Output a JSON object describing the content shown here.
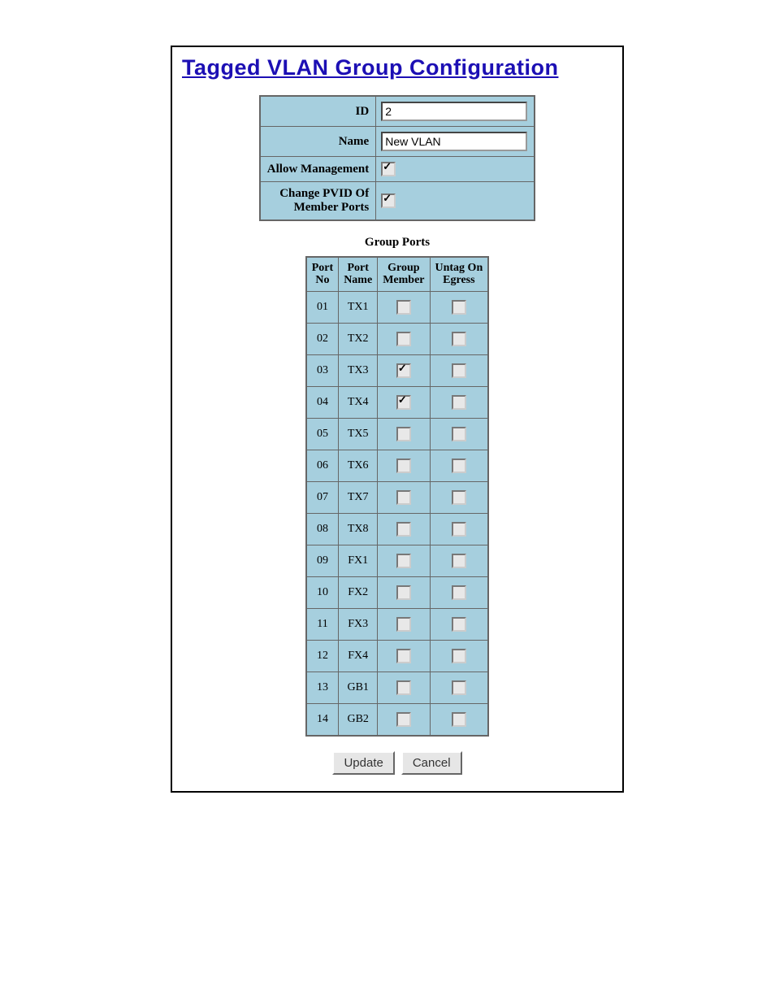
{
  "title": "Tagged VLAN Group Configuration",
  "config": {
    "id_label": "ID",
    "id_value": "2",
    "name_label": "Name",
    "name_value": "New VLAN",
    "allow_mgmt_label": "Allow Management",
    "allow_mgmt_checked": true,
    "change_pvid_label_line1": "Change PVID Of",
    "change_pvid_label_line2": "Member Ports",
    "change_pvid_checked": true
  },
  "group_ports_title": "Group Ports",
  "ports_headers": {
    "port_no": "Port\nNo",
    "port_name": "Port\nName",
    "group_member": "Group\nMember",
    "untag_on_egress": "Untag On\nEgress"
  },
  "ports": [
    {
      "no": "01",
      "name": "TX1",
      "member": false,
      "untag": false
    },
    {
      "no": "02",
      "name": "TX2",
      "member": false,
      "untag": false
    },
    {
      "no": "03",
      "name": "TX3",
      "member": true,
      "untag": false
    },
    {
      "no": "04",
      "name": "TX4",
      "member": true,
      "untag": false
    },
    {
      "no": "05",
      "name": "TX5",
      "member": false,
      "untag": false
    },
    {
      "no": "06",
      "name": "TX6",
      "member": false,
      "untag": false
    },
    {
      "no": "07",
      "name": "TX7",
      "member": false,
      "untag": false
    },
    {
      "no": "08",
      "name": "TX8",
      "member": false,
      "untag": false
    },
    {
      "no": "09",
      "name": "FX1",
      "member": false,
      "untag": false
    },
    {
      "no": "10",
      "name": "FX2",
      "member": false,
      "untag": false
    },
    {
      "no": "11",
      "name": "FX3",
      "member": false,
      "untag": false
    },
    {
      "no": "12",
      "name": "FX4",
      "member": false,
      "untag": false
    },
    {
      "no": "13",
      "name": "GB1",
      "member": false,
      "untag": false
    },
    {
      "no": "14",
      "name": "GB2",
      "member": false,
      "untag": false
    }
  ],
  "buttons": {
    "update": "Update",
    "cancel": "Cancel"
  }
}
